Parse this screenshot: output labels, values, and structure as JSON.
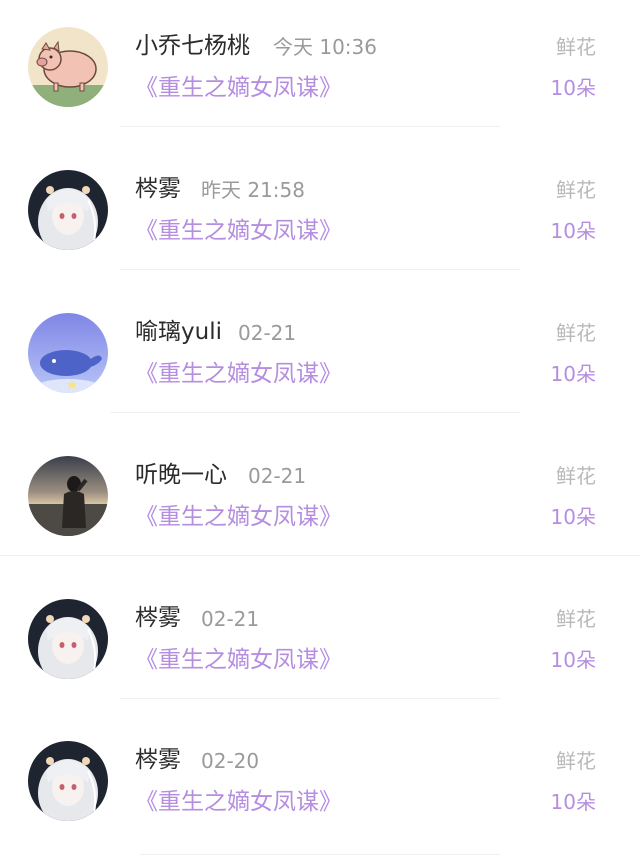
{
  "records": [
    {
      "user_name": "小乔七杨桃",
      "time": "今天 10:36",
      "book_title": "《重生之嫡女凤谋》",
      "gift_type": "鲜花",
      "gift_count": "10朵",
      "avatar_icon": "pig-avatar"
    },
    {
      "user_name": "梣雾",
      "time": "昨天 21:58",
      "book_title": "《重生之嫡女凤谋》",
      "gift_type": "鲜花",
      "gift_count": "10朵",
      "avatar_icon": "anime-girl-avatar"
    },
    {
      "user_name": "喻璃yuli",
      "time": "02-21",
      "book_title": "《重生之嫡女凤谋》",
      "gift_type": "鲜花",
      "gift_count": "10朵",
      "avatar_icon": "whale-avatar"
    },
    {
      "user_name": "听晚一心",
      "time": "02-21",
      "book_title": "《重生之嫡女凤谋》",
      "gift_type": "鲜花",
      "gift_count": "10朵",
      "avatar_icon": "sunset-person-avatar"
    },
    {
      "user_name": "梣雾",
      "time": "02-21",
      "book_title": "《重生之嫡女凤谋》",
      "gift_type": "鲜花",
      "gift_count": "10朵",
      "avatar_icon": "anime-girl-avatar"
    },
    {
      "user_name": "梣雾",
      "time": "02-20",
      "book_title": "《重生之嫡女凤谋》",
      "gift_type": "鲜花",
      "gift_count": "10朵",
      "avatar_icon": "anime-girl-avatar"
    }
  ],
  "colors": {
    "book_title": "#b58ee0",
    "gift_count": "#b58ee0",
    "gift_type": "#b9b9b9",
    "time": "#9a9a9a",
    "user_name": "#2b2b2b"
  }
}
